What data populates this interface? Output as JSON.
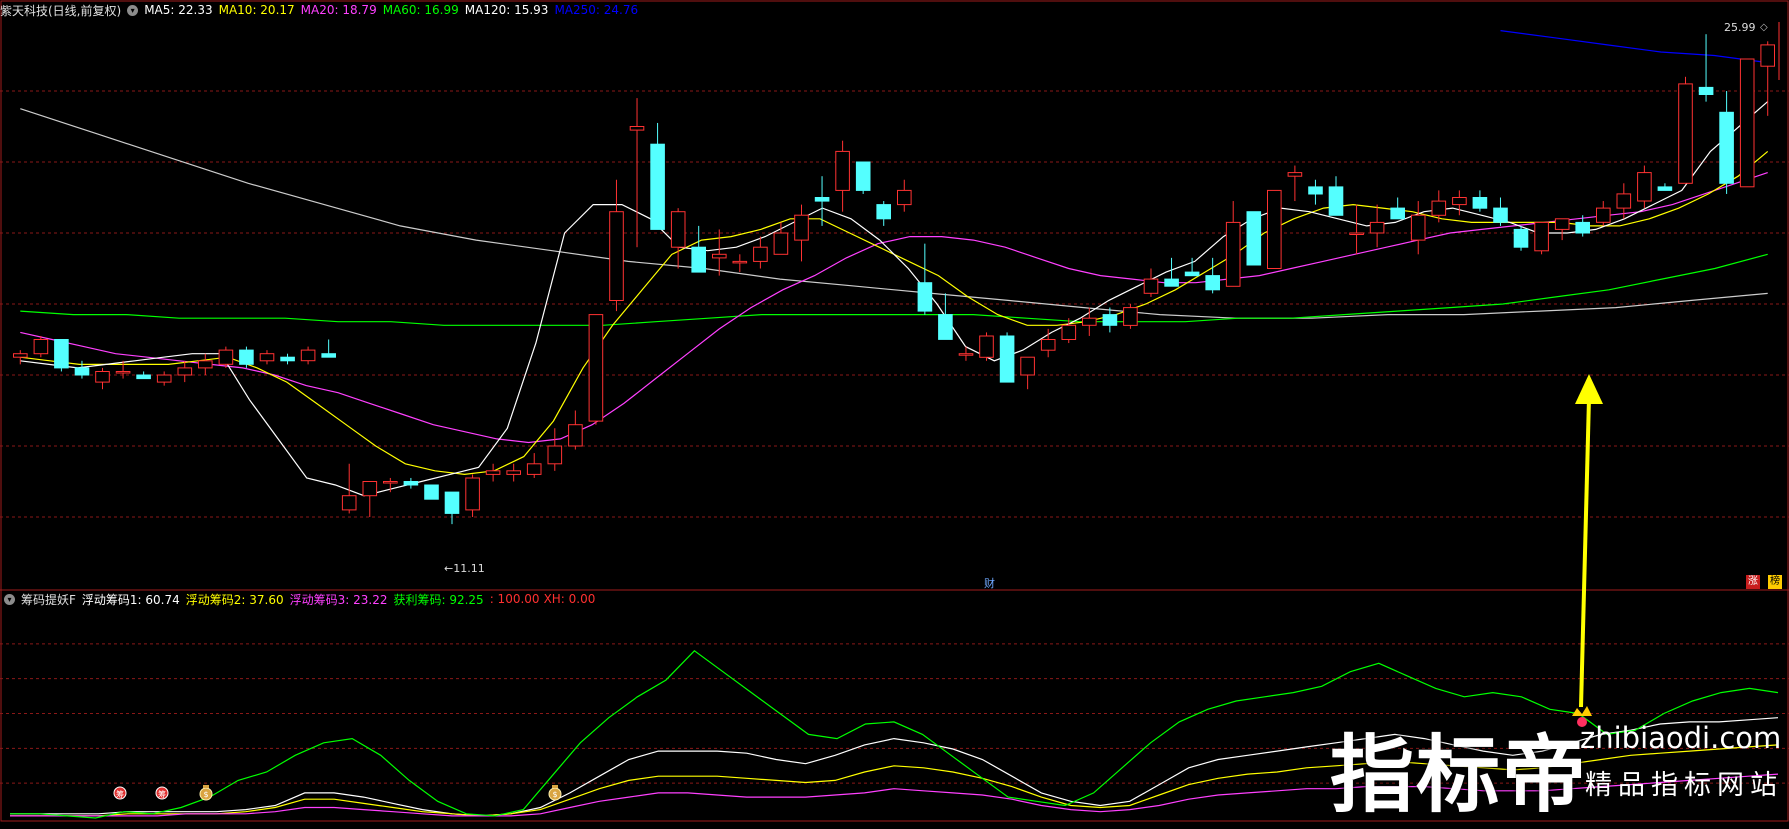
{
  "main_header": {
    "stock_title": "紫天科技(日线,前复权)",
    "items": [
      {
        "label": "MA5: 22.33",
        "color": "#ffffff"
      },
      {
        "label": "MA10: 20.17",
        "color": "#ffff00"
      },
      {
        "label": "MA20: 18.79",
        "color": "#ff40ff"
      },
      {
        "label": "MA60: 16.99",
        "color": "#00ff00"
      },
      {
        "label": "MA120: 15.93",
        "color": "#ffffff"
      },
      {
        "label": "MA250: 24.76",
        "color": "#0000ff"
      }
    ]
  },
  "sub_header": {
    "indicator_title": "筹码提妖F",
    "items": [
      {
        "label": "浮动筹码1: 60.74",
        "color": "#ffffff"
      },
      {
        "label": "浮动筹码2: 37.60",
        "color": "#ffff00"
      },
      {
        "label": "浮动筹码3: 23.22",
        "color": "#ff40ff"
      },
      {
        "label": "获利筹码: 92.25",
        "color": "#00ff00"
      },
      {
        "label": ": 100.00",
        "color": "#ff3030"
      },
      {
        "label": "XH: 0.00",
        "color": "#ff3030"
      }
    ]
  },
  "annotations": {
    "high_price": "25.99",
    "low_price": "11.11",
    "finance_marker": "财",
    "badge_up": "涨",
    "badge_hot": "榜"
  },
  "watermark": {
    "brand": "指标帝",
    "domain": "zhibiaodi.com",
    "tagline": "精品指标网站"
  },
  "colors": {
    "up": "#ff3232",
    "down": "#54ffff",
    "grid": "#8a1818",
    "arrow": "#ffff00",
    "ma5": "#ffffff",
    "ma10": "#ffff00",
    "ma20": "#ff40ff",
    "ma60": "#00ff00",
    "ma120": "#cccccc",
    "ma250": "#0000ff"
  },
  "chart_data": {
    "type": "candlestick",
    "y_range": [
      10.6,
      26.6
    ],
    "candles": [
      [
        17.1,
        17.3,
        16.9,
        17.2
      ],
      [
        17.2,
        17.7,
        17.1,
        17.6
      ],
      [
        17.6,
        17.6,
        16.7,
        16.8
      ],
      [
        16.8,
        17.0,
        16.5,
        16.6
      ],
      [
        16.4,
        16.8,
        16.2,
        16.7
      ],
      [
        16.7,
        17.0,
        16.5,
        16.7
      ],
      [
        16.6,
        16.7,
        16.5,
        16.5
      ],
      [
        16.4,
        16.7,
        16.3,
        16.6
      ],
      [
        16.6,
        17.0,
        16.4,
        16.8
      ],
      [
        16.8,
        17.2,
        16.6,
        17.0
      ],
      [
        16.9,
        17.4,
        16.8,
        17.3
      ],
      [
        17.3,
        17.4,
        16.8,
        16.9
      ],
      [
        17.0,
        17.3,
        16.9,
        17.2
      ],
      [
        17.1,
        17.2,
        16.9,
        17.0
      ],
      [
        17.0,
        17.4,
        16.9,
        17.3
      ],
      [
        17.2,
        17.6,
        17.1,
        17.1
      ],
      [
        12.8,
        14.1,
        12.7,
        13.2
      ],
      [
        13.2,
        13.6,
        12.6,
        13.6
      ],
      [
        13.6,
        13.7,
        13.3,
        13.6
      ],
      [
        13.6,
        13.7,
        13.4,
        13.5
      ],
      [
        13.5,
        13.5,
        13.1,
        13.1
      ],
      [
        13.3,
        13.3,
        12.4,
        12.7
      ],
      [
        12.8,
        13.8,
        12.6,
        13.7
      ],
      [
        13.8,
        14.1,
        13.6,
        13.9
      ],
      [
        13.8,
        14.1,
        13.6,
        13.9
      ],
      [
        13.8,
        14.4,
        13.7,
        14.1
      ],
      [
        14.1,
        15.1,
        13.9,
        14.6
      ],
      [
        14.6,
        15.6,
        14.5,
        15.2
      ],
      [
        15.3,
        18.3,
        15.2,
        18.3
      ],
      [
        18.7,
        22.1,
        18.4,
        21.2
      ],
      [
        23.5,
        24.4,
        20.2,
        23.6
      ],
      [
        23.1,
        23.7,
        20.7,
        20.7
      ],
      [
        20.2,
        21.3,
        19.6,
        21.2
      ],
      [
        20.2,
        20.8,
        19.5,
        19.5
      ],
      [
        19.9,
        20.7,
        19.4,
        20.0
      ],
      [
        19.8,
        20.0,
        19.5,
        19.8
      ],
      [
        19.8,
        20.5,
        19.6,
        20.2
      ],
      [
        20.0,
        20.9,
        20.0,
        20.6
      ],
      [
        20.4,
        21.4,
        19.8,
        21.1
      ],
      [
        21.6,
        22.2,
        20.8,
        21.5
      ],
      [
        21.8,
        23.2,
        21.2,
        22.9
      ],
      [
        22.6,
        22.6,
        21.7,
        21.8
      ],
      [
        21.4,
        21.5,
        20.8,
        21.0
      ],
      [
        21.4,
        22.1,
        21.2,
        21.8
      ],
      [
        19.2,
        20.3,
        18.3,
        18.4
      ],
      [
        18.3,
        18.9,
        17.6,
        17.6
      ],
      [
        17.2,
        17.4,
        17.0,
        17.2
      ],
      [
        17.1,
        17.8,
        17.0,
        17.7
      ],
      [
        17.7,
        17.8,
        16.4,
        16.4
      ],
      [
        16.6,
        17.0,
        16.2,
        17.1
      ],
      [
        17.3,
        17.9,
        17.1,
        17.6
      ],
      [
        17.6,
        18.2,
        17.5,
        18.0
      ],
      [
        18.0,
        18.5,
        17.7,
        18.2
      ],
      [
        18.3,
        18.5,
        17.8,
        18.0
      ],
      [
        18.0,
        18.6,
        17.9,
        18.5
      ],
      [
        18.9,
        19.6,
        18.8,
        19.3
      ],
      [
        19.3,
        19.9,
        19.1,
        19.1
      ],
      [
        19.5,
        19.9,
        19.4,
        19.4
      ],
      [
        19.4,
        19.9,
        18.9,
        19.0
      ],
      [
        19.1,
        21.5,
        19.1,
        20.9
      ],
      [
        21.2,
        21.2,
        19.7,
        19.7
      ],
      [
        19.6,
        21.8,
        19.6,
        21.8
      ],
      [
        22.2,
        22.5,
        21.5,
        22.3
      ],
      [
        21.9,
        22.1,
        21.4,
        21.7
      ],
      [
        21.9,
        22.2,
        21.1,
        21.1
      ],
      [
        20.6,
        21.4,
        20.0,
        20.6
      ],
      [
        20.6,
        21.4,
        20.2,
        20.9
      ],
      [
        21.3,
        21.6,
        21.0,
        21.0
      ],
      [
        20.4,
        21.5,
        20.0,
        21.1
      ],
      [
        21.1,
        21.8,
        20.9,
        21.5
      ],
      [
        21.4,
        21.8,
        21.1,
        21.6
      ],
      [
        21.6,
        21.8,
        21.2,
        21.3
      ],
      [
        21.3,
        21.6,
        20.8,
        20.9
      ],
      [
        20.7,
        20.8,
        20.1,
        20.2
      ],
      [
        20.1,
        20.9,
        20.0,
        20.9
      ],
      [
        20.7,
        21.0,
        20.4,
        21.0
      ],
      [
        20.9,
        21.1,
        20.5,
        20.6
      ],
      [
        20.9,
        21.5,
        20.8,
        21.3
      ],
      [
        21.3,
        22.0,
        21.0,
        21.7
      ],
      [
        21.5,
        22.5,
        21.3,
        22.3
      ],
      [
        21.9,
        22.0,
        21.8,
        21.8
      ],
      [
        22.0,
        25.0,
        22.0,
        24.8
      ],
      [
        24.7,
        26.2,
        24.3,
        24.5
      ],
      [
        24.0,
        24.6,
        21.7,
        22.0
      ],
      [
        21.9,
        24.9,
        21.9,
        25.5
      ],
      [
        25.3,
        26.0,
        23.9,
        25.9
      ]
    ],
    "ma5": [
      17.0,
      16.9,
      16.8,
      16.9,
      17.0,
      17.1,
      17.2,
      17.2,
      15.9,
      14.8,
      13.7,
      13.5,
      13.2,
      13.4,
      13.6,
      13.8,
      14.0,
      15.1,
      17.5,
      20.6,
      21.4,
      21.4,
      21.0,
      20.2,
      20.1,
      20.2,
      20.5,
      20.9,
      21.3,
      21.0,
      20.4,
      19.6,
      18.6,
      17.4,
      17.0,
      17.3,
      17.8,
      18.2,
      18.7,
      19.1,
      19.5,
      19.8,
      20.5,
      21.0,
      21.3,
      21.2,
      21.0,
      20.8,
      20.9,
      21.2,
      21.3,
      21.1,
      20.9,
      20.6,
      20.6,
      20.7,
      21.0,
      21.4,
      21.8,
      22.9,
      23.6,
      24.3
    ],
    "ma10": [
      17.1,
      17.0,
      16.9,
      16.9,
      16.9,
      16.9,
      17.0,
      17.1,
      16.8,
      16.4,
      15.8,
      15.2,
      14.6,
      14.1,
      13.9,
      13.8,
      13.9,
      14.3,
      15.3,
      16.8,
      18.0,
      19.0,
      20.0,
      20.4,
      20.5,
      20.7,
      21.0,
      21.0,
      20.6,
      20.2,
      19.8,
      19.4,
      18.8,
      18.3,
      18.0,
      18.0,
      18.1,
      18.3,
      18.6,
      19.0,
      19.5,
      20.0,
      20.6,
      21.0,
      21.3,
      21.4,
      21.3,
      21.2,
      21.0,
      20.9,
      20.9,
      20.9,
      20.9,
      20.8,
      20.8,
      21.0,
      21.3,
      21.7,
      22.2,
      22.9
    ],
    "ma20": [
      17.8,
      17.6,
      17.4,
      17.2,
      17.1,
      17.0,
      16.9,
      16.8,
      16.6,
      16.3,
      16.1,
      15.8,
      15.5,
      15.2,
      15.0,
      14.8,
      14.7,
      14.8,
      15.2,
      15.8,
      16.5,
      17.2,
      17.9,
      18.5,
      19.0,
      19.4,
      19.9,
      20.3,
      20.5,
      20.5,
      20.4,
      20.2,
      19.9,
      19.6,
      19.4,
      19.3,
      19.2,
      19.2,
      19.3,
      19.4,
      19.6,
      19.8,
      20.0,
      20.2,
      20.4,
      20.6,
      20.7,
      20.8,
      20.9,
      21.0,
      21.1,
      21.2,
      21.4,
      21.7,
      22.0,
      22.3
    ],
    "ma60": [
      18.4,
      18.3,
      18.3,
      18.2,
      18.2,
      18.2,
      18.1,
      18.1,
      18.0,
      18.0,
      18.0,
      18.0,
      18.1,
      18.2,
      18.3,
      18.3,
      18.3,
      18.3,
      18.3,
      18.2,
      18.1,
      18.1,
      18.1,
      18.2,
      18.2,
      18.3,
      18.4,
      18.5,
      18.6,
      18.8,
      19.0,
      19.3,
      19.6,
      20.0
    ],
    "ma120": [
      24.1,
      23.4,
      22.7,
      22.0,
      21.4,
      20.8,
      20.4,
      20.1,
      19.8,
      19.6,
      19.3,
      19.1,
      18.9,
      18.7,
      18.5,
      18.3,
      18.2,
      18.2,
      18.3,
      18.3,
      18.4,
      18.5,
      18.7,
      18.9
    ],
    "ma250": [
      26.3,
      26.1,
      25.9,
      25.7,
      25.6,
      25.4
    ]
  },
  "indicator_data": {
    "type": "line",
    "y_range": [
      0,
      100
    ],
    "series": [
      {
        "name": "浮动筹码1",
        "color": "#ffffff",
        "values": [
          2,
          2,
          2,
          2,
          3,
          3,
          3,
          3,
          4,
          6,
          12,
          12,
          10,
          7,
          4,
          2,
          1,
          2,
          5,
          12,
          20,
          28,
          32,
          32,
          32,
          31,
          28,
          26,
          30,
          35,
          38,
          36,
          33,
          28,
          20,
          12,
          8,
          6,
          8,
          16,
          24,
          28,
          30,
          32,
          34,
          36,
          38,
          40,
          38,
          35,
          32,
          30,
          32,
          36,
          40,
          42,
          45,
          46,
          46,
          47,
          48
        ]
      },
      {
        "name": "浮动筹码2",
        "color": "#ffff00",
        "values": [
          1,
          1,
          1,
          1,
          2,
          2,
          2,
          2,
          3,
          5,
          9,
          9,
          7,
          5,
          3,
          2,
          1,
          2,
          4,
          9,
          14,
          18,
          20,
          20,
          20,
          19,
          18,
          17,
          18,
          22,
          25,
          24,
          22,
          19,
          15,
          10,
          6,
          5,
          6,
          11,
          16,
          19,
          21,
          22,
          24,
          25,
          26,
          27,
          26,
          25,
          24,
          23,
          24,
          26,
          28,
          30,
          31,
          32,
          33,
          34,
          35
        ]
      },
      {
        "name": "浮动筹码3",
        "color": "#ff40ff",
        "values": [
          1,
          1,
          1,
          1,
          1,
          1,
          2,
          2,
          2,
          3,
          5,
          5,
          4,
          3,
          2,
          1,
          1,
          1,
          2,
          5,
          8,
          10,
          12,
          12,
          11,
          10,
          10,
          10,
          11,
          12,
          14,
          13,
          12,
          11,
          9,
          6,
          4,
          3,
          4,
          6,
          9,
          11,
          12,
          13,
          14,
          14,
          15,
          15,
          15,
          14,
          13,
          13,
          13,
          14,
          15,
          16,
          17,
          18,
          19,
          20,
          21
        ]
      },
      {
        "name": "获利筹码",
        "color": "#00ff00",
        "values": [
          2,
          2,
          1,
          0,
          3,
          2,
          5,
          10,
          18,
          22,
          30,
          36,
          38,
          30,
          18,
          8,
          2,
          1,
          4,
          20,
          36,
          48,
          58,
          66,
          80,
          70,
          60,
          50,
          40,
          38,
          45,
          46,
          40,
          30,
          20,
          10,
          8,
          6,
          12,
          24,
          36,
          46,
          52,
          56,
          58,
          60,
          63,
          70,
          74,
          68,
          62,
          58,
          60,
          58,
          52,
          50,
          40,
          42,
          50,
          56,
          60,
          62,
          60
        ]
      }
    ],
    "signals": [
      {
        "type": "chip",
        "label": "筹"
      },
      {
        "type": "chip",
        "label": "筹"
      },
      {
        "type": "money",
        "label": "$"
      },
      {
        "type": "money",
        "label": "$"
      }
    ]
  }
}
